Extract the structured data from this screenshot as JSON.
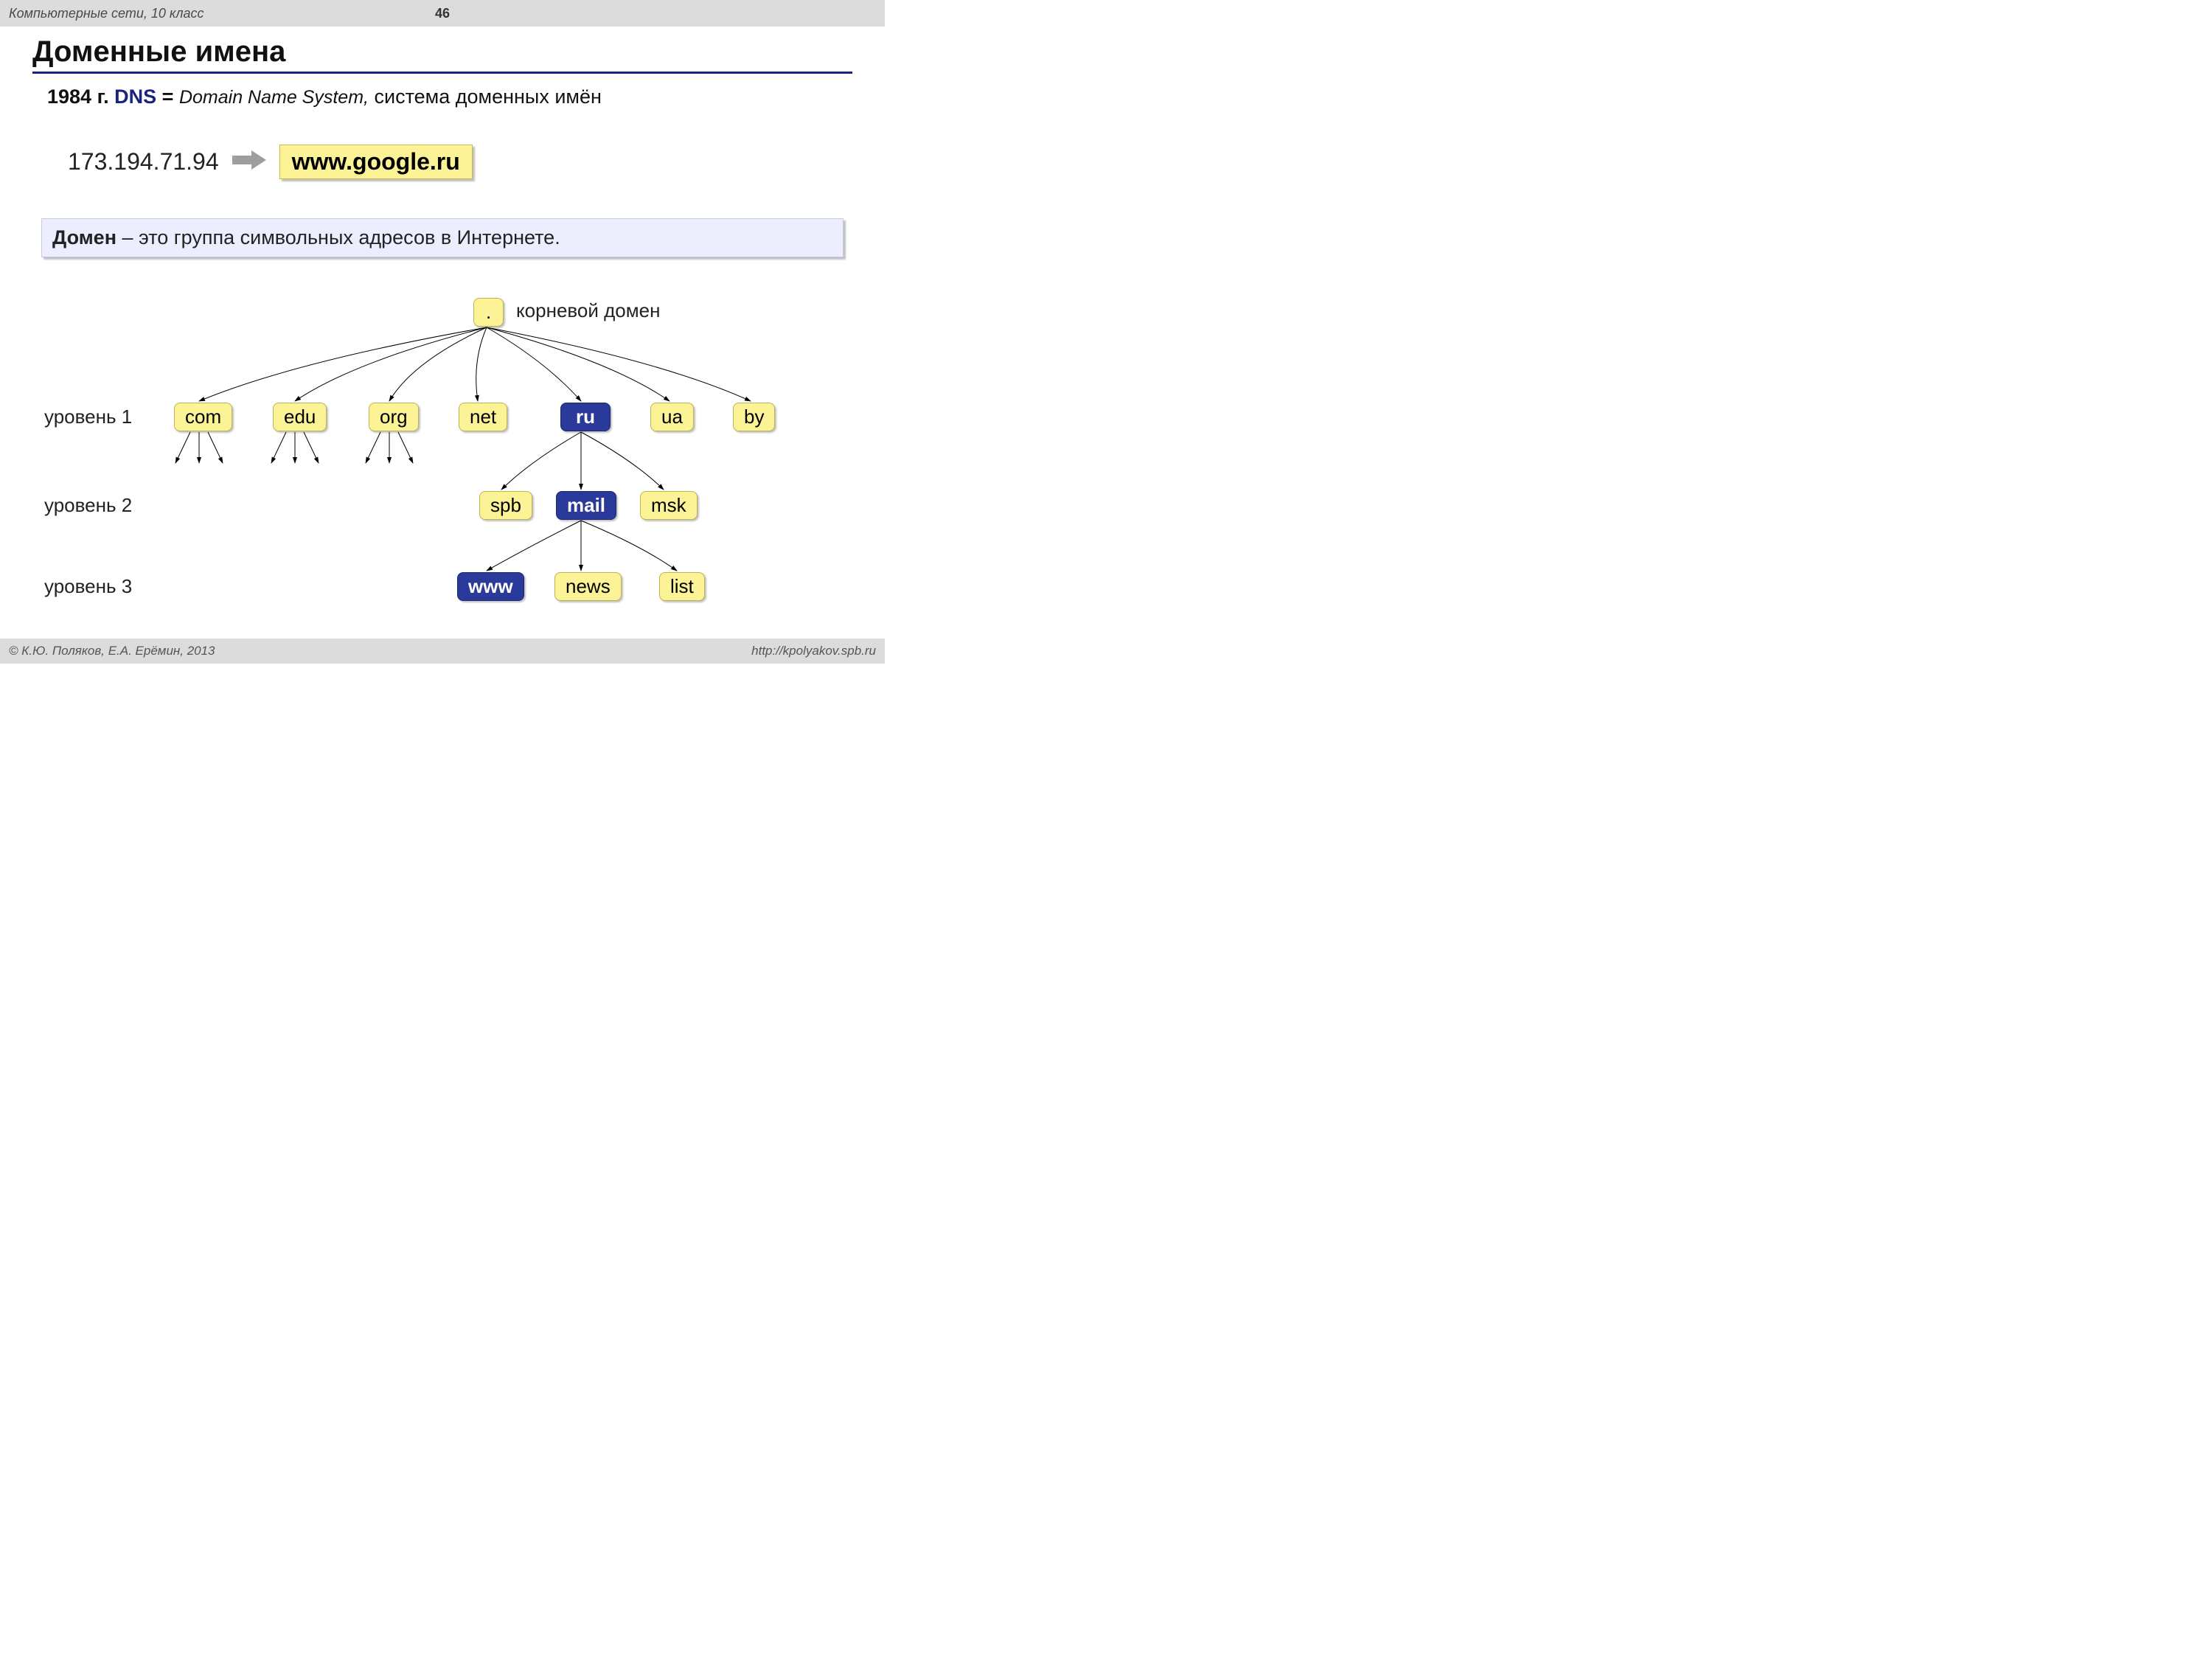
{
  "header": {
    "course": "Компьютерные сети, 10 класс",
    "slide_no": "46"
  },
  "title": "Доменные имена",
  "intro": {
    "year": "1984 г.",
    "dns": "DNS",
    "eq": " = ",
    "dnsys": "Domain Name System,",
    "tail": " система доменных имён"
  },
  "iprow": {
    "ip": "173.194.71.94",
    "target": "www.google.ru"
  },
  "definition": {
    "term": "Домен",
    "body": " – это группа символьных адресов в Интернете."
  },
  "tree": {
    "root": ".",
    "root_label": "корневой домен",
    "levels": {
      "l1": "уровень 1",
      "l2": "уровень 2",
      "l3": "уровень 3"
    },
    "level1": [
      "com",
      "edu",
      "org",
      "net",
      "ru",
      "ua",
      "by"
    ],
    "ru_children": [
      "spb",
      "mail",
      "msk"
    ],
    "mail_children": [
      "www",
      "news",
      "list"
    ]
  },
  "footer": {
    "left": "© К.Ю. Поляков, Е.А. Ерёмин, 2013",
    "right": "http://kpolyakov.spb.ru"
  },
  "colors": {
    "accent_blue": "#2a3a9b",
    "yellow": "#fbf396"
  }
}
